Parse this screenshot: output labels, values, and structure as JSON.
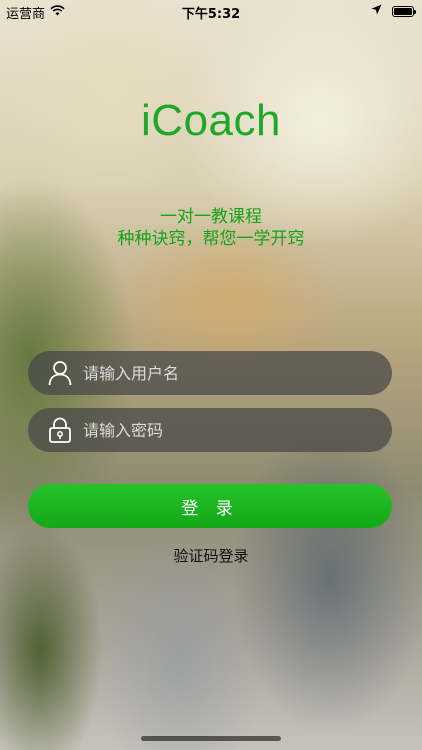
{
  "status_bar": {
    "carrier": "运营商",
    "time": "下午5:32",
    "icons": [
      "wifi-icon",
      "location-arrow-icon",
      "battery-icon"
    ],
    "battery_level": 1.0
  },
  "app": {
    "title": "iCoach",
    "tagline_line1": "一对一教课程",
    "tagline_line2": "种种诀窍，帮您一学开窍",
    "accent_color": "#1ea82a"
  },
  "login_form": {
    "username_placeholder": "请输入用户名",
    "password_placeholder": "请输入密码",
    "username_icon": "user-icon",
    "password_icon": "lock-icon",
    "login_button_label": "登 录",
    "login_button_color": "#1cb620",
    "code_login_link": "验证码登录"
  }
}
